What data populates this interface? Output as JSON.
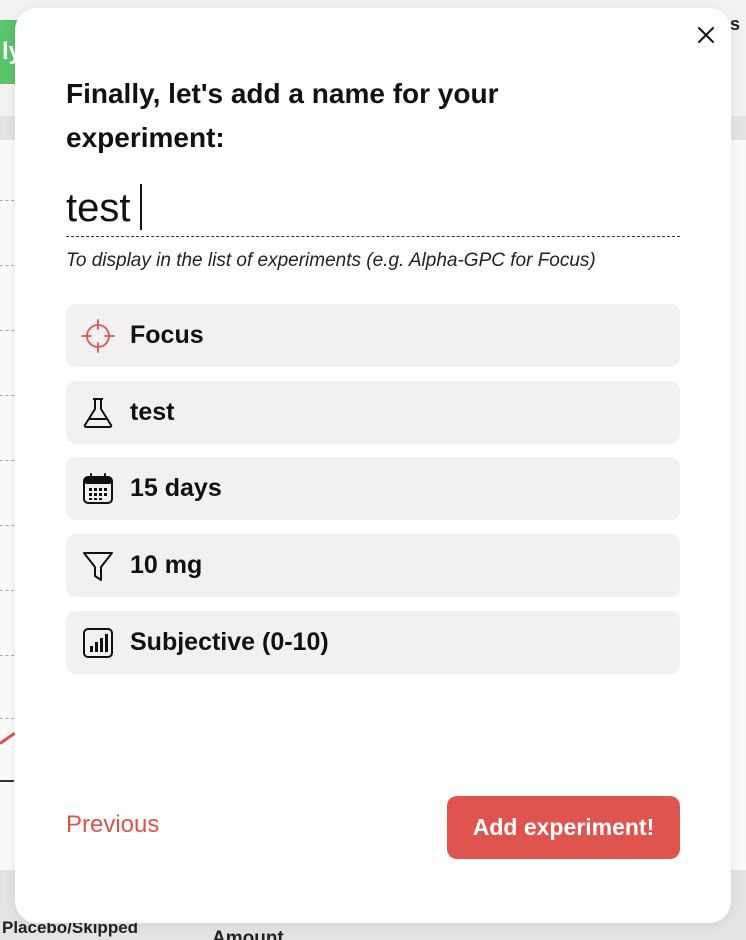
{
  "background": {
    "green_button_text": "ly",
    "corner_text": "s",
    "bottom_left_label": "Placebo/Skipped",
    "bottom_mid_label": "Amount"
  },
  "modal": {
    "title": "Finally, let's add a name for your experiment:",
    "name_value": "test",
    "hint": "To display in the list of experiments (e.g. Alpha-GPC for Focus)",
    "summary": [
      {
        "label": "Focus",
        "icon": "target-icon"
      },
      {
        "label": "test",
        "icon": "flask-icon"
      },
      {
        "label": "15 days",
        "icon": "calendar-icon"
      },
      {
        "label": "10 mg",
        "icon": "funnel-icon"
      },
      {
        "label": "Subjective (0-10)",
        "icon": "bar-chart-icon"
      }
    ],
    "previous_label": "Previous",
    "add_label": "Add experiment!"
  },
  "colors": {
    "accent_red": "#e05450",
    "row_background": "#f1f1f3",
    "green": "#5cc46a"
  }
}
